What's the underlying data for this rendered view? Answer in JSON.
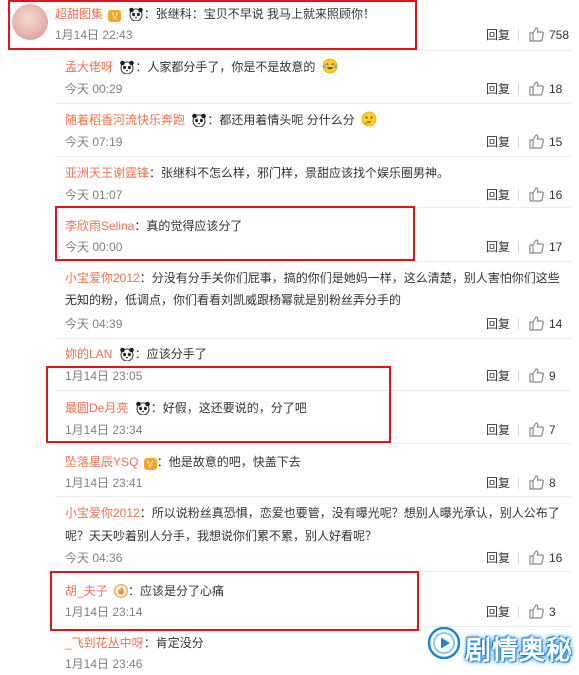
{
  "comments": [
    {
      "user": "超甜图集",
      "has_vip_badge": true,
      "vip_badge_text": "V",
      "emoji_after_name": "panda",
      "text": "张继科：宝贝不早说 我马上就来照顾你！",
      "text_emoji": null,
      "time": "1月14日 22:43",
      "reply": "回复",
      "likes": "758",
      "is_top": true
    },
    {
      "user": "孟大佬呀",
      "has_vip_badge": false,
      "emoji_after_name": "panda",
      "text": "人家都分手了，你是不是故意的",
      "text_emoji": "laugh-cry",
      "time": "今天 00:29",
      "reply": "回复",
      "likes": "18"
    },
    {
      "user": "随着稻香河流快乐奔跑",
      "has_vip_badge": false,
      "emoji_after_name": "panda",
      "text": "都还用着情头呢  分什么分",
      "text_emoji": "thinking",
      "time": "今天 07:19",
      "reply": "回复",
      "likes": "15"
    },
    {
      "user": "亚洲天王谢霆锋",
      "has_vip_badge": false,
      "emoji_after_name": null,
      "text": "张继科不怎么样，邪门样，景甜应该找个娱乐圈男神。",
      "text_emoji": null,
      "time": "今天 01:07",
      "reply": "回复",
      "likes": "16"
    },
    {
      "user": "李欣雨Selina",
      "has_vip_badge": false,
      "emoji_after_name": null,
      "text": "真的觉得应该分了",
      "text_emoji": null,
      "time": "今天 00:00",
      "reply": "回复",
      "likes": "17"
    },
    {
      "user": "小宝爱你2012",
      "has_vip_badge": false,
      "emoji_after_name": null,
      "text": "分没有分手关你们屁事，搞的你们是她妈一样，这么清楚，别人害怕你们这些",
      "text2": "无知的粉，低调点，你们看看刘凯威跟杨幂就是别粉丝弄分手的",
      "text_emoji": null,
      "time": "今天 04:39",
      "reply": "回复",
      "likes": "14"
    },
    {
      "user": "妳的LAN",
      "has_vip_badge": false,
      "emoji_after_name": "panda",
      "text": "应该分手了",
      "text_emoji": null,
      "time": "1月14日 23:05",
      "reply": "回复",
      "likes": "9"
    },
    {
      "user": "最圆De月亮",
      "has_vip_badge": false,
      "emoji_after_name": "panda",
      "text": "好假，这还要说的，分了吧",
      "text_emoji": null,
      "time": "1月14日 23:34",
      "reply": "回复",
      "likes": "7"
    },
    {
      "user": "坠落星辰YSQ",
      "has_vip_badge": true,
      "vip_badge_text": "V",
      "emoji_after_name": null,
      "text": "他是故意的吧，快盖下去",
      "text_emoji": null,
      "time": "1月14日 23:41",
      "reply": "回复",
      "likes": "8"
    },
    {
      "user": "小宝爱你2012",
      "has_vip_badge": false,
      "emoji_after_name": null,
      "text": "所以说粉丝真恐惧，恋爱也要管，没有曝光呢？想别人曝光承认，别人公布了",
      "text2": "呢？天天吵着别人分手，我想说你们累不累，别人好看呢？",
      "text_emoji": null,
      "time": "今天 04:36",
      "reply": "回复",
      "likes": "16"
    },
    {
      "user": "胡_夫子",
      "has_vip_badge": false,
      "emoji_after_name": "fire-badge",
      "text": "应该是分了心痛",
      "text_emoji": null,
      "time": "1月14日 23:14",
      "reply": "回复",
      "likes": "3"
    },
    {
      "user": "_飞到花丛中呀",
      "has_vip_badge": false,
      "emoji_after_name": null,
      "text": "肯定没分",
      "text_emoji": null,
      "time": "1月14日 23:46",
      "reply": "回复",
      "likes": ""
    }
  ],
  "watermark": {
    "text": "剧情奥秘",
    "icon": "play-circle-icon"
  },
  "colors": {
    "username": "#eb7350",
    "highlight_box": "#e2141b",
    "watermark": "#1f86d6"
  }
}
